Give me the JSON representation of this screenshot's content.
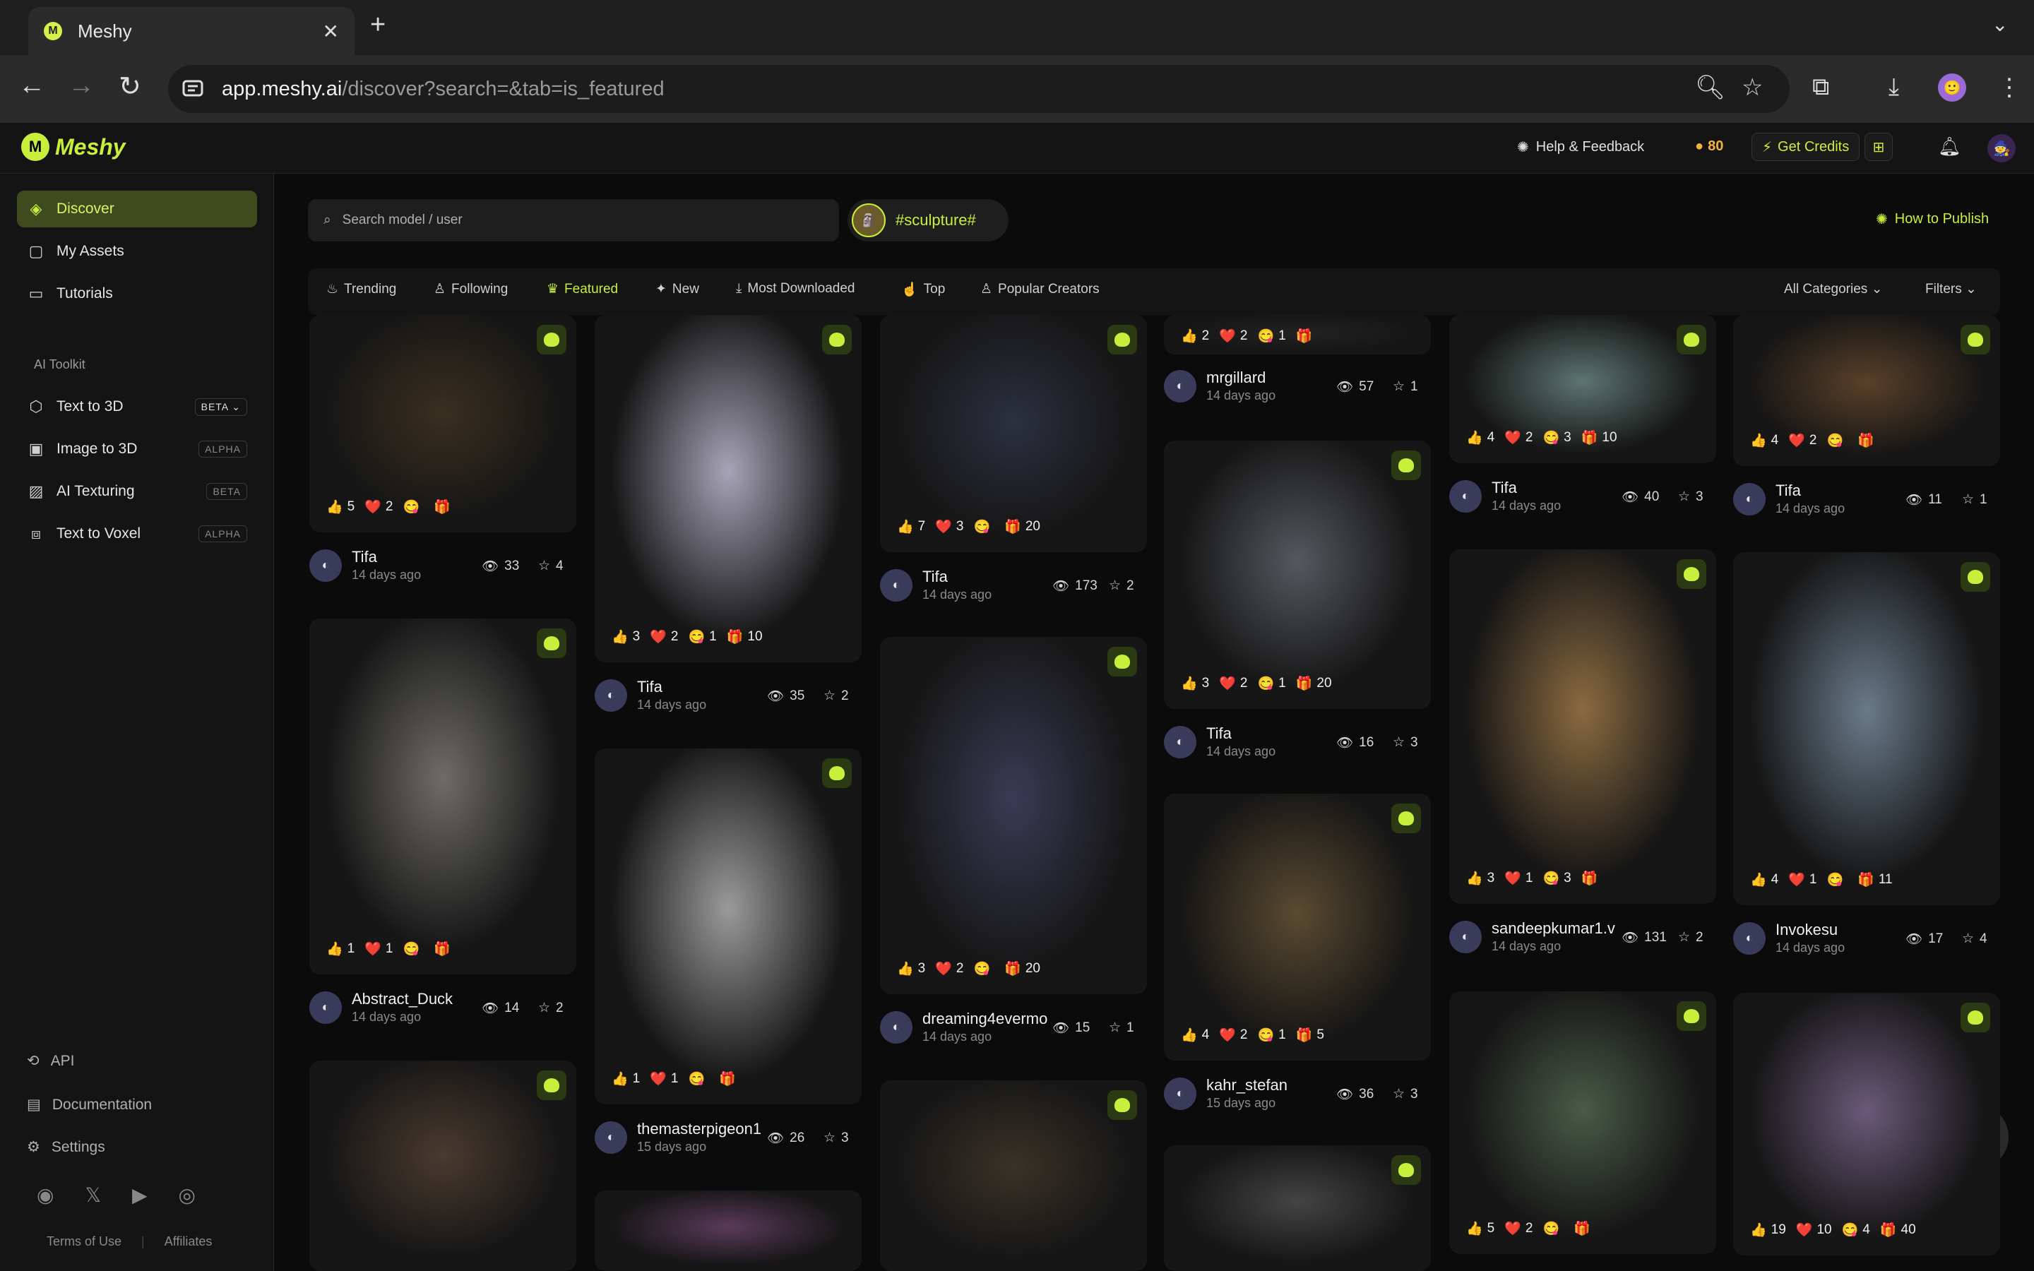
{
  "browser": {
    "tab_title": "Meshy",
    "url_host": "app.meshy.ai",
    "url_path": "/discover?search=&tab=is_featured"
  },
  "header": {
    "logo": "Meshy",
    "help": "Help & Feedback",
    "credits": "80",
    "get_credits": "Get Credits"
  },
  "sidebar": {
    "items": [
      {
        "label": "Discover"
      },
      {
        "label": "My Assets"
      },
      {
        "label": "Tutorials"
      }
    ],
    "toolkit_label": "AI Toolkit",
    "tools": [
      {
        "label": "Text to 3D",
        "badge": "BETA"
      },
      {
        "label": "Image to 3D",
        "badge": "ALPHA"
      },
      {
        "label": "AI Texturing",
        "badge": "BETA"
      },
      {
        "label": "Text to Voxel",
        "badge": "ALPHA"
      }
    ],
    "bottom": [
      {
        "label": "API"
      },
      {
        "label": "Documentation"
      },
      {
        "label": "Settings"
      }
    ],
    "terms": "Terms of Use",
    "affiliates": "Affiliates"
  },
  "search": {
    "placeholder": "Search model / user"
  },
  "tag": "#sculpture#",
  "how_to_publish": "How to Publish",
  "filter_tabs": [
    {
      "label": "Trending"
    },
    {
      "label": "Following"
    },
    {
      "label": "Featured"
    },
    {
      "label": "New"
    },
    {
      "label": "Most Downloaded"
    },
    {
      "label": "Top"
    },
    {
      "label": "Popular Creators"
    }
  ],
  "all_categories": "All Categories",
  "filters": "Filters",
  "cards": [
    {
      "user": "Tifa",
      "date": "14 days ago",
      "views": "33",
      "stars": "4",
      "r": [
        "5",
        "2",
        "",
        ""
      ]
    },
    {
      "user": "Abstract_Duck",
      "date": "14 days ago",
      "views": "14",
      "stars": "2",
      "r": [
        "1",
        "1",
        "",
        ""
      ]
    },
    {
      "user": "",
      "date": "",
      "views": "",
      "stars": "",
      "r": []
    },
    {
      "user": "Tifa",
      "date": "14 days ago",
      "views": "35",
      "stars": "2",
      "r": [
        "3",
        "2",
        "1",
        "10"
      ]
    },
    {
      "user": "themasterpigeon1",
      "date": "15 days ago",
      "views": "26",
      "stars": "3",
      "r": [
        "1",
        "1",
        "",
        ""
      ]
    },
    {
      "user": "",
      "date": "",
      "views": "",
      "stars": "",
      "r": []
    },
    {
      "user": "Tifa",
      "date": "14 days ago",
      "views": "173",
      "stars": "2",
      "r": [
        "7",
        "3",
        "",
        "20"
      ]
    },
    {
      "user": "dreaming4evermo",
      "date": "14 days ago",
      "views": "15",
      "stars": "1",
      "r": [
        "3",
        "2",
        "",
        "20"
      ]
    },
    {
      "user": "",
      "date": "",
      "views": "",
      "stars": "",
      "r": []
    },
    {
      "user": "mrgillard",
      "date": "14 days ago",
      "views": "57",
      "stars": "1",
      "r": [
        "2",
        "2",
        "1",
        ""
      ]
    },
    {
      "user": "Tifa",
      "date": "14 days ago",
      "views": "16",
      "stars": "3",
      "r": [
        "3",
        "2",
        "1",
        "20"
      ]
    },
    {
      "user": "kahr_stefan",
      "date": "15 days ago",
      "views": "36",
      "stars": "3",
      "r": [
        "4",
        "2",
        "1",
        "5"
      ]
    },
    {
      "user": "",
      "date": "",
      "views": "",
      "stars": "",
      "r": []
    },
    {
      "user": "Tifa",
      "date": "14 days ago",
      "views": "40",
      "stars": "3",
      "r": [
        "4",
        "2",
        "3",
        "10"
      ]
    },
    {
      "user": "sandeepkumar1.v",
      "date": "14 days ago",
      "views": "131",
      "stars": "2",
      "r": [
        "3",
        "1",
        "3",
        ""
      ]
    },
    {
      "user": "",
      "date": "",
      "views": "",
      "stars": "",
      "r": [
        "5",
        "2",
        "",
        ""
      ]
    },
    {
      "user": "Tifa",
      "date": "14 days ago",
      "views": "11",
      "stars": "1",
      "r": [
        "4",
        "2",
        "",
        ""
      ]
    },
    {
      "user": "Invokesu",
      "date": "14 days ago",
      "views": "17",
      "stars": "4",
      "r": [
        "4",
        "1",
        "",
        "11"
      ]
    },
    {
      "user": "",
      "date": "",
      "views": "",
      "stars": "",
      "r": [
        "19",
        "10",
        "4",
        "40"
      ]
    }
  ]
}
